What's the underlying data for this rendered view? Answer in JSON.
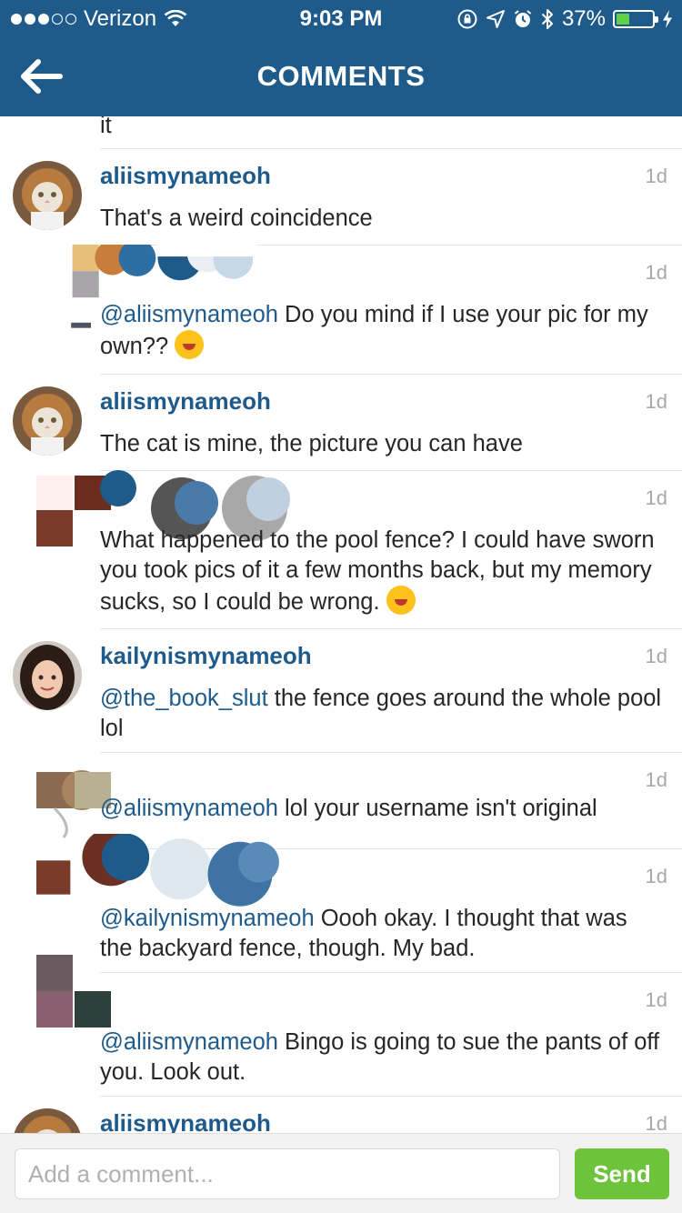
{
  "status_bar": {
    "carrier": "Verizon",
    "time": "9:03 PM",
    "battery": "37%",
    "battery_level": 0.37,
    "signal_bars_filled": 3,
    "signal_bars_total": 5,
    "icons": [
      "wifi-icon",
      "rotation-lock-icon",
      "location-arrow-icon",
      "alarm-icon",
      "bluetooth-icon",
      "charging-bolt-icon"
    ]
  },
  "header": {
    "title": "COMMENTS",
    "back_icon": "arrow-left-icon"
  },
  "theme": {
    "header_color": "#1e5a8a",
    "username_color": "#1e5a8a",
    "send_button_color": "#6ec33c"
  },
  "partial_top_text": "it",
  "comments": [
    {
      "username": "aliismynameoh",
      "time": "1d",
      "mention": "",
      "text": "That's a weird coincidence",
      "emoji": ""
    },
    {
      "username": "",
      "time": "1d",
      "mention": "@aliismynameoh",
      "text": " Do you mind if I use your pic for my own?? ",
      "emoji": "tears-of-joy-emoji"
    },
    {
      "username": "aliismynameoh",
      "time": "1d",
      "mention": "",
      "text": "The cat is mine, the picture you can have",
      "emoji": ""
    },
    {
      "username": "",
      "time": "1d",
      "mention": "",
      "text": "What happened to the pool fence? I could have sworn you took pics of it a few months back, but my memory sucks, so I could be wrong. ",
      "emoji": "tongue-squint-emoji"
    },
    {
      "username": "kailynismynameoh",
      "time": "1d",
      "mention": "@the_book_slut",
      "text": " the fence goes around the whole pool lol",
      "emoji": ""
    },
    {
      "username": "",
      "time": "1d",
      "mention": "@aliismynameoh",
      "text": " lol your username isn't original",
      "emoji": ""
    },
    {
      "username": "",
      "time": "1d",
      "mention": "@kailynismynameoh",
      "text": " Oooh okay. I thought that was the backyard fence, though. My bad.",
      "emoji": ""
    },
    {
      "username": "",
      "time": "1d",
      "mention": "@aliismynameoh",
      "text": " Bingo is going to sue the pants of off you. Look out.",
      "emoji": ""
    },
    {
      "username": "aliismynameoh",
      "time": "1d",
      "mention": "",
      "text": "",
      "emoji": ""
    }
  ],
  "input_bar": {
    "placeholder": "Add a comment...",
    "send_label": "Send"
  }
}
